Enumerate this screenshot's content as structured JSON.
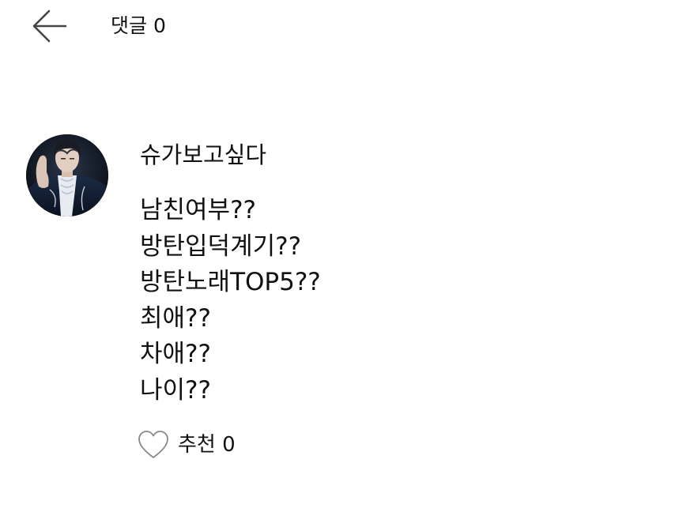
{
  "header": {
    "back_icon": "arrow-left-icon",
    "title": "댓글 0"
  },
  "comment": {
    "avatar": "profile-photo",
    "author": "슈가보고싶다",
    "lines": [
      "남친여부??",
      "방탄입덕계기??",
      "방탄노래TOP5??",
      "최애??",
      "차애??",
      "나이??"
    ],
    "like_icon": "heart-outline-icon",
    "like_label": "추천 0"
  },
  "colors": {
    "text": "#111111",
    "icon_stroke": "#444444",
    "heart_stroke": "#8a8a8a",
    "background": "#ffffff"
  }
}
